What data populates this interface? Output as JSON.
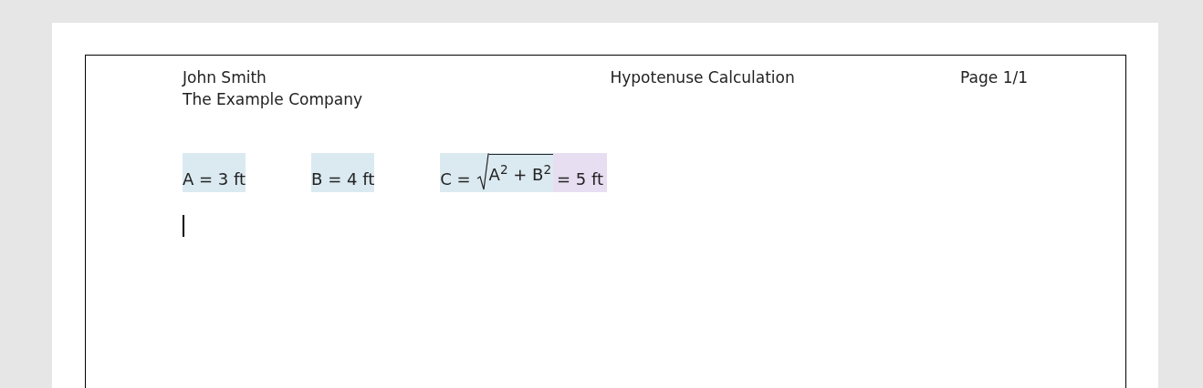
{
  "header": {
    "author": "John Smith",
    "company": "The Example Company",
    "title": "Hypotenuse Calculation",
    "page": "Page 1/1"
  },
  "expressions": [
    {
      "kind": "plain",
      "text": "A = 3 ft",
      "color": "#dbeaf1"
    },
    {
      "kind": "plain",
      "text": "B = 4 ft",
      "color": "#dbeaf1"
    },
    {
      "kind": "sqrt",
      "lhs": "C =",
      "radicand": "A$^{2}$ + B$^{2}$",
      "color": "#dbeaf1",
      "result": {
        "text": "= 5 ft",
        "color": "#e8def2"
      }
    }
  ],
  "text_cursor": true
}
